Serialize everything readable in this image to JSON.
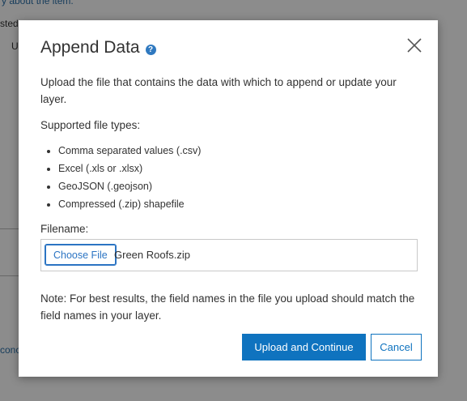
{
  "background": {
    "top_text": "y about the item.",
    "left_text_1": "sted",
    "left_text_2": "U",
    "left_text_3": "conc"
  },
  "dialog": {
    "title": "Append Data",
    "help_icon": "?",
    "description": "Upload the file that contains the data with which to append or update your layer.",
    "supported_label": "Supported file types:",
    "file_types": [
      "Comma separated values (.csv)",
      "Excel (.xls or .xlsx)",
      "GeoJSON (.geojson)",
      "Compressed (.zip) shapefile"
    ],
    "filename_label": "Filename:",
    "choose_file_label": "Choose File",
    "selected_file": "Green Roofs.zip",
    "note": "Note: For best results, the field names in the file you upload should match the field names in your layer.",
    "upload_label": "Upload and Continue",
    "cancel_label": "Cancel"
  },
  "colors": {
    "primary": "#0f73bf",
    "help_icon": "#2f79c0",
    "overlay": "rgba(0,0,0,0.45)"
  }
}
